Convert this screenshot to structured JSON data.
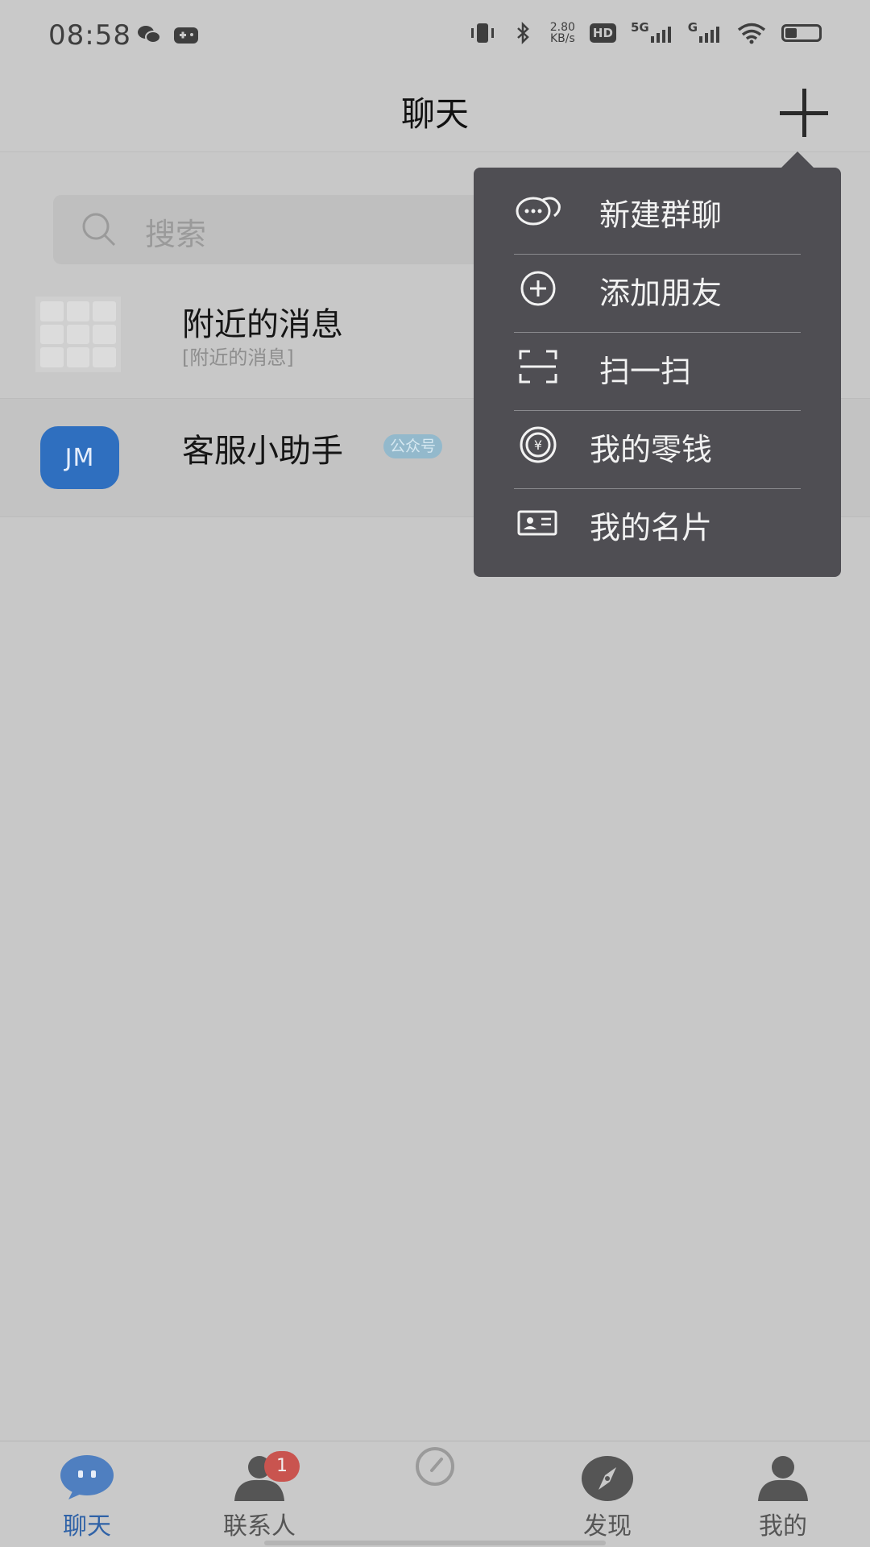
{
  "status_bar": {
    "time": "08:58",
    "speed_value": "2.80",
    "speed_unit": "KB/s",
    "hd_label": "HD",
    "net_5g": "5G",
    "net_g": "G"
  },
  "header": {
    "title": "聊天"
  },
  "search": {
    "placeholder": "搜索"
  },
  "chats": [
    {
      "name": "附近的消息",
      "preview": "[附近的消息]"
    },
    {
      "name": "客服小助手",
      "avatar_text": "JM",
      "badge": "公众号"
    }
  ],
  "menu": {
    "items": [
      {
        "label": "新建群聊",
        "icon": "group-chat-icon"
      },
      {
        "label": "添加朋友",
        "icon": "add-friend-icon"
      },
      {
        "label": "扫一扫",
        "icon": "scan-icon"
      },
      {
        "label": "我的零钱",
        "icon": "wallet-icon"
      },
      {
        "label": "我的名片",
        "icon": "business-card-icon"
      }
    ]
  },
  "tabs": [
    {
      "label": "聊天",
      "icon": "chat-icon",
      "active": true
    },
    {
      "label": "联系人",
      "icon": "contacts-icon",
      "badge": "1"
    },
    {
      "label": "",
      "icon": "dashboard-icon"
    },
    {
      "label": "发现",
      "icon": "compass-icon"
    },
    {
      "label": "我的",
      "icon": "profile-icon"
    }
  ],
  "colors": {
    "active_tab": "#2f62a7",
    "menu_bg": "#4f4e53",
    "badge_red": "#c9544f",
    "avatar_blue": "#2f6fbf"
  }
}
